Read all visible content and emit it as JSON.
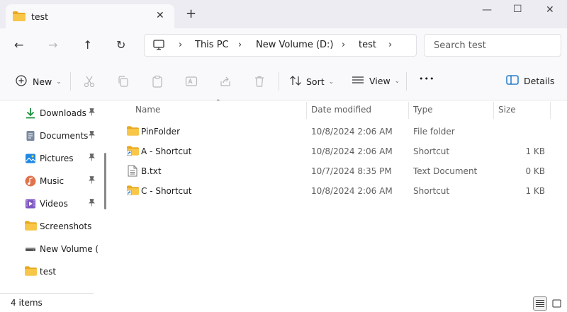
{
  "tab": {
    "title": "test",
    "close_glyph": "✕",
    "new_tab_glyph": "+"
  },
  "window": {
    "minimize_glyph": "—",
    "maximize_glyph": "☐",
    "close_glyph": "✕"
  },
  "nav": {
    "back_glyph": "←",
    "forward_glyph": "→",
    "up_glyph": "↑",
    "refresh_glyph": "↻"
  },
  "address": {
    "crumbs": [
      "This PC",
      "New Volume (D:)",
      "test"
    ],
    "chevron": "›"
  },
  "search": {
    "placeholder": "Search test"
  },
  "commands": {
    "new_label": "New",
    "sort_label": "Sort",
    "view_label": "View",
    "more_glyph": "•••",
    "details_label": "Details",
    "caret_glyph": "⌄"
  },
  "sidebar": {
    "items": [
      {
        "label": "Downloads",
        "icon": "download-icon",
        "pinned": true
      },
      {
        "label": "Documents",
        "icon": "documents-icon",
        "pinned": true
      },
      {
        "label": "Pictures",
        "icon": "pictures-icon",
        "pinned": true
      },
      {
        "label": "Music",
        "icon": "music-icon",
        "pinned": true
      },
      {
        "label": "Videos",
        "icon": "videos-icon",
        "pinned": true
      },
      {
        "label": "Screenshots",
        "icon": "folder-icon",
        "pinned": false
      },
      {
        "label": "New Volume (D:)",
        "icon": "drive-icon",
        "pinned": false
      },
      {
        "label": "test",
        "icon": "folder-icon",
        "pinned": false
      }
    ],
    "pin_glyph": "📌"
  },
  "columns": {
    "name": "Name",
    "date": "Date modified",
    "type": "Type",
    "size": "Size",
    "sort_glyph": "⌃"
  },
  "files": [
    {
      "name": "PinFolder",
      "date": "10/8/2024 2:06 AM",
      "type": "File folder",
      "size": "",
      "icon": "folder-icon"
    },
    {
      "name": "A - Shortcut",
      "date": "10/8/2024 2:06 AM",
      "type": "Shortcut",
      "size": "1 KB",
      "icon": "folder-shortcut-icon"
    },
    {
      "name": "B.txt",
      "date": "10/7/2024 8:35 PM",
      "type": "Text Document",
      "size": "0 KB",
      "icon": "text-file-icon"
    },
    {
      "name": "C - Shortcut",
      "date": "10/8/2024 2:06 AM",
      "type": "Shortcut",
      "size": "1 KB",
      "icon": "folder-shortcut-icon"
    }
  ],
  "status": {
    "count": "4 items"
  },
  "colors": {
    "folder": "#f8c74a",
    "folder_dark": "#e8a920",
    "accent": "#0067c0",
    "download": "#1a8f3c"
  }
}
